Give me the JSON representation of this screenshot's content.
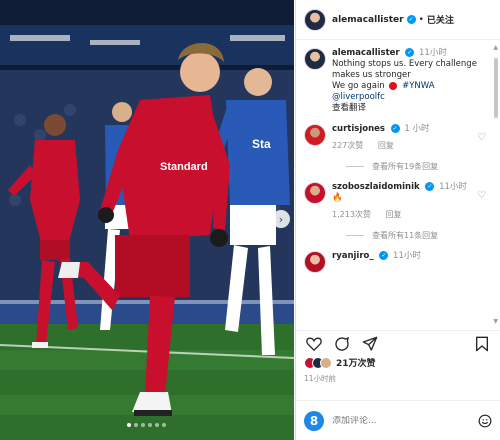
{
  "header": {
    "username": "alemacallister",
    "verified_mark": "✓",
    "separator": "•",
    "follow_label": "已关注"
  },
  "caption": {
    "username": "alemacallister",
    "time": "11小时",
    "line1": "Nothing stops us. Every challenge",
    "line2": "makes us stronger",
    "line3_prefix": "We go again",
    "hashtag": "#YNWA",
    "mention": "@liverpoolfc",
    "translate": "查看翻译"
  },
  "comments": [
    {
      "username": "curtisjones",
      "time": "1 小时",
      "text": "",
      "likes": "227次赞",
      "reply": "回复",
      "view_replies": "查看所有19条回复"
    },
    {
      "username": "szoboszlaidominik",
      "time": "11小时",
      "text": "🔥",
      "likes": "1,213次赞",
      "reply": "回复",
      "view_replies": "查看所有11条回复"
    },
    {
      "username": "ryanjiro_",
      "time": "11小时",
      "text": ""
    }
  ],
  "post": {
    "likes_label": "21万次赞",
    "posted_time": "11小时前"
  },
  "comment_box": {
    "placeholder": "添加评论...",
    "emoji_glyph": "8"
  },
  "carousel": {
    "next_glyph": "›",
    "dot_count": 6,
    "active_index": 0
  },
  "colors": {
    "verified_blue": "#0095f6",
    "liverpool_red": "#c8102e",
    "everton_blue": "#2a5ab8",
    "secondary_text": "#8e8e8e"
  }
}
